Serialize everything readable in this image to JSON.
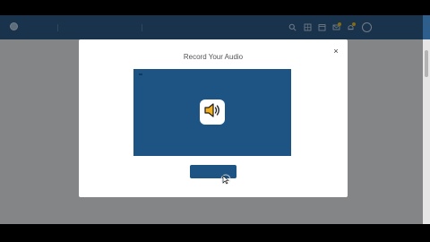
{
  "app": {
    "logo_text": "",
    "nav": [
      {
        "label": ""
      },
      {
        "label": ""
      },
      {
        "label": ""
      },
      {
        "label": ""
      }
    ],
    "user_name": "",
    "user_initials": ""
  },
  "page": {
    "title": "",
    "lines": [
      "",
      "",
      "",
      ""
    ]
  },
  "modal": {
    "title": "Record Your Audio",
    "close_label": "×",
    "stage_tag": "",
    "stop_button_label": ""
  },
  "colors": {
    "navbar": "#2e5e8c",
    "stage": "#1d5484",
    "speaker_icon": "#f2b01e"
  },
  "icons": {
    "close": "close-icon",
    "speaker": "speaker-icon",
    "search": "search-icon",
    "bell": "bell-icon",
    "cursor": "mouse-cursor-icon"
  }
}
